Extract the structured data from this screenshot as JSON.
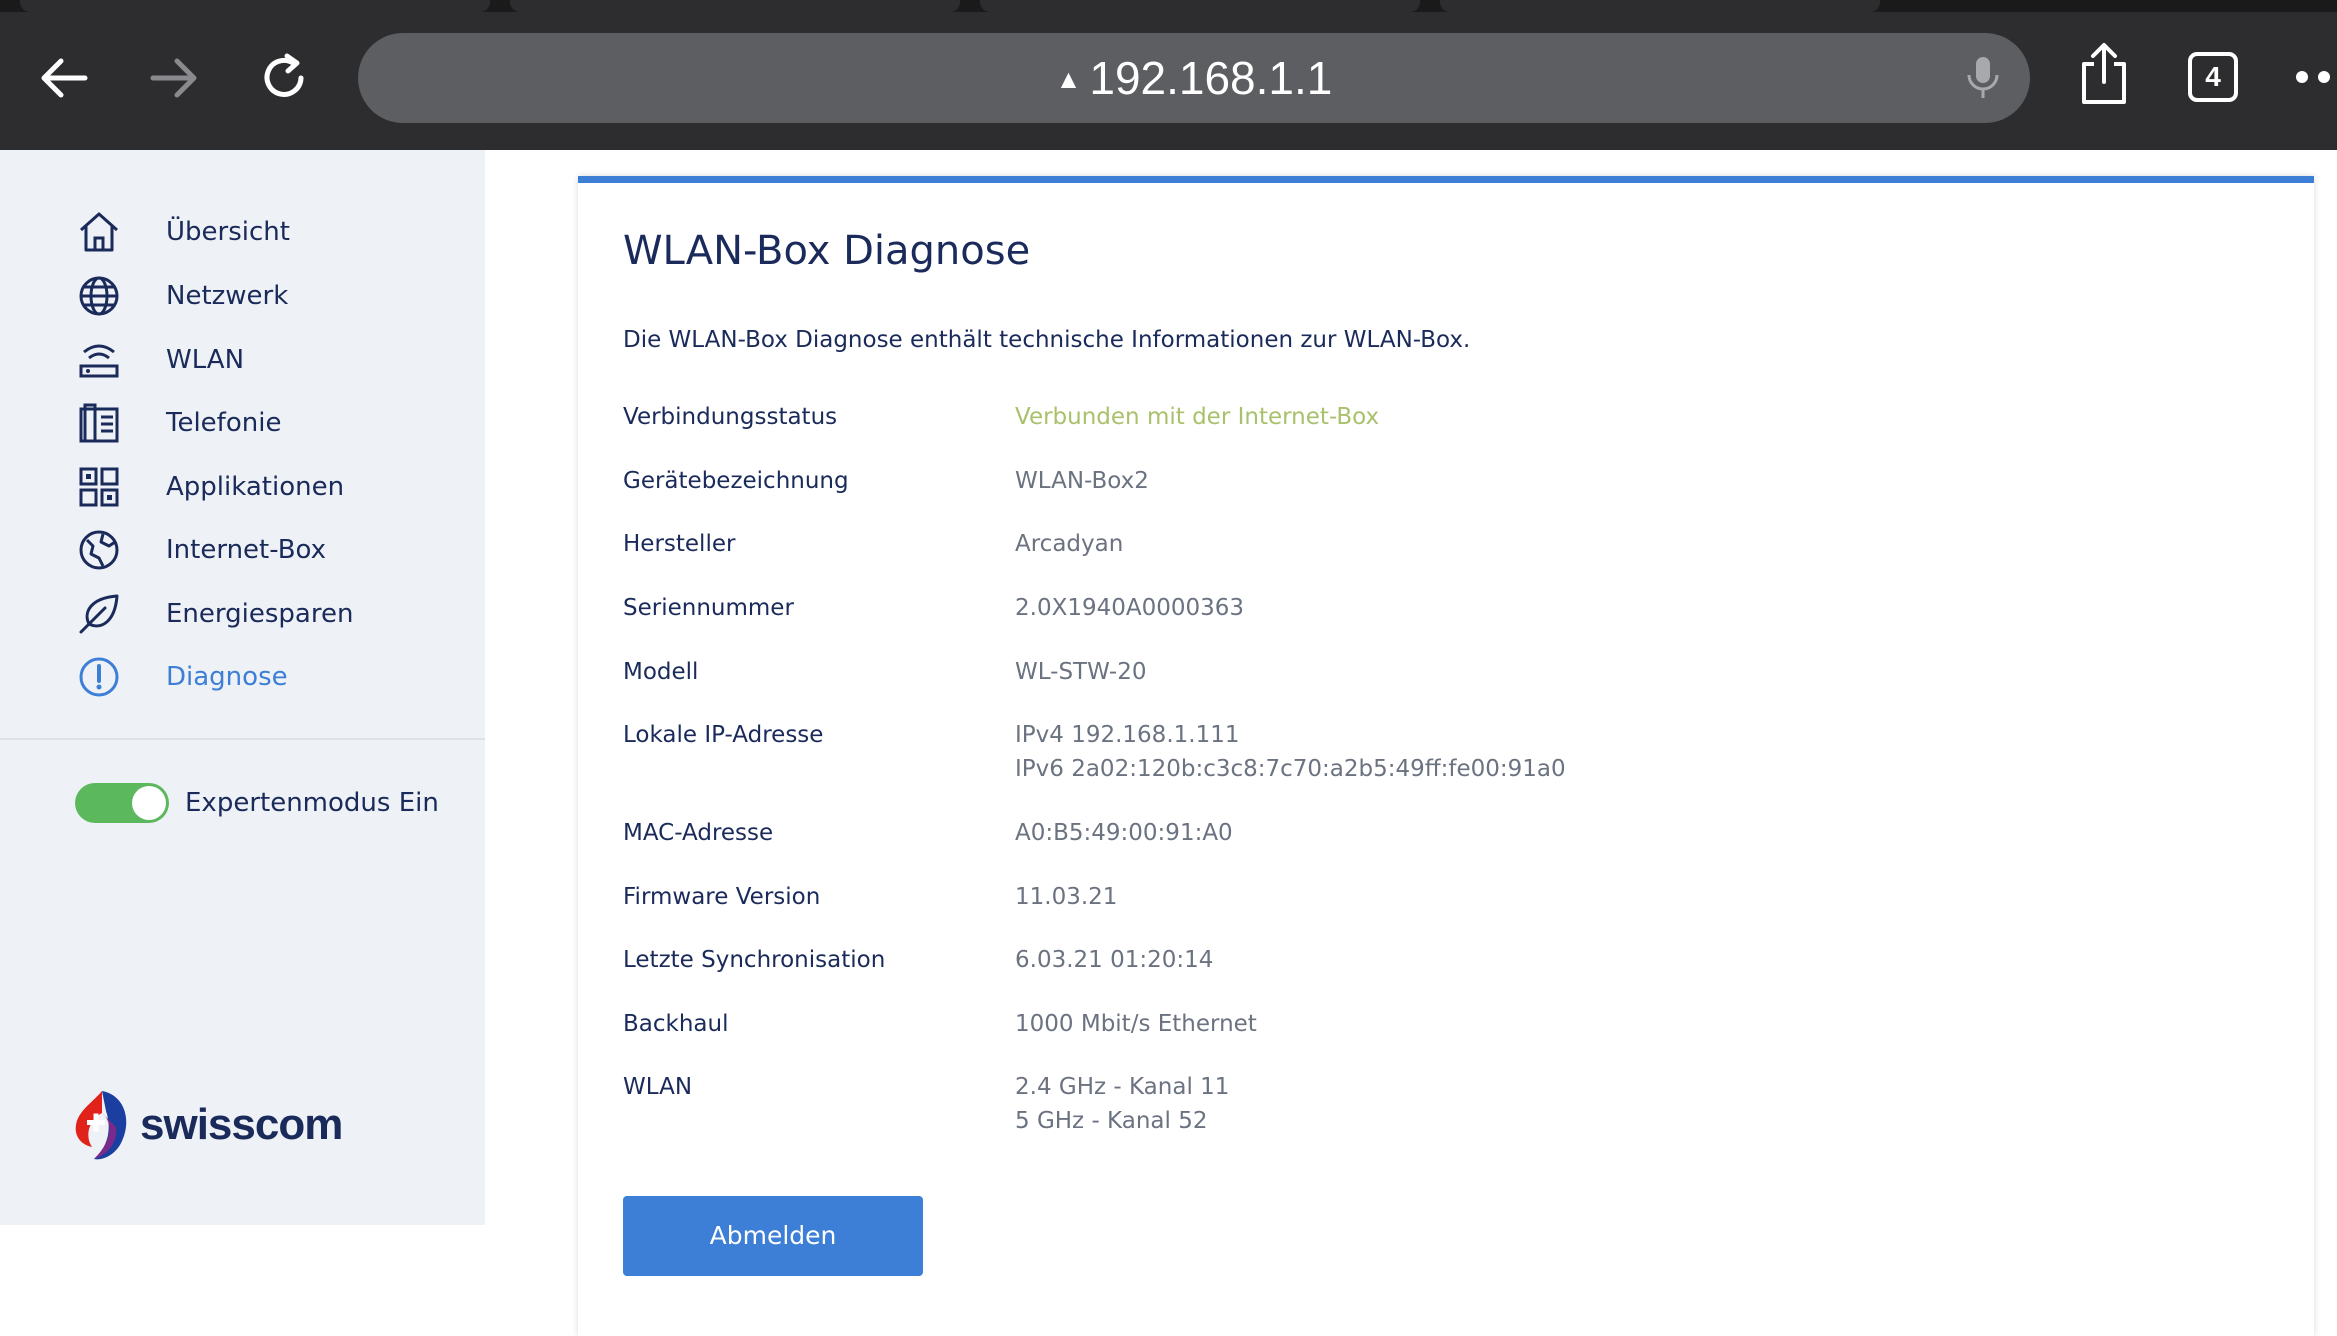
{
  "browser": {
    "url": "192.168.1.1",
    "tab_count": "4"
  },
  "sidebar": {
    "items": [
      {
        "label": "Übersicht",
        "icon": "home-icon"
      },
      {
        "label": "Netzwerk",
        "icon": "globe-icon"
      },
      {
        "label": "WLAN",
        "icon": "router-icon"
      },
      {
        "label": "Telefonie",
        "icon": "phone-icon"
      },
      {
        "label": "Applikationen",
        "icon": "apps-icon"
      },
      {
        "label": "Internet-Box",
        "icon": "internet-box-icon"
      },
      {
        "label": "Energiesparen",
        "icon": "leaf-icon"
      },
      {
        "label": "Diagnose",
        "icon": "alert-circle-icon"
      }
    ],
    "active_item": "Diagnose",
    "expert_mode_label": "Expertenmodus Ein",
    "expert_mode_on": true,
    "logo_text": "swisscom"
  },
  "main": {
    "title": "WLAN-Box Diagnose",
    "description": "Die WLAN-Box Diagnose enthält technische Informationen zur WLAN-Box.",
    "rows": [
      {
        "label": "Verbindungsstatus",
        "lines": [
          "Verbunden mit der Internet-Box"
        ]
      },
      {
        "label": "Gerätebezeichnung",
        "lines": [
          "WLAN-Box2"
        ]
      },
      {
        "label": "Hersteller",
        "lines": [
          "Arcadyan"
        ]
      },
      {
        "label": "Seriennummer",
        "lines": [
          "2.0X1940A0000363"
        ]
      },
      {
        "label": "Modell",
        "lines": [
          "WL-STW-20"
        ]
      },
      {
        "label": "Lokale IP-Adresse",
        "lines": [
          "IPv4 192.168.1.111",
          "IPv6 2a02:120b:c3c8:7c70:a2b5:49ff:fe00:91a0"
        ]
      },
      {
        "label": "MAC-Adresse",
        "lines": [
          "A0:B5:49:00:91:A0"
        ]
      },
      {
        "label": "Firmware Version",
        "lines": [
          "11.03.21"
        ]
      },
      {
        "label": "Letzte Synchronisation",
        "lines": [
          "6.03.21 01:20:14"
        ]
      },
      {
        "label": "Backhaul",
        "lines": [
          "1000 Mbit/s Ethernet"
        ]
      },
      {
        "label": "WLAN",
        "lines": [
          "2.4 GHz - Kanal 11",
          "5 GHz - Kanal 52"
        ]
      }
    ],
    "logout_label": "Abmelden"
  },
  "colors": {
    "accent": "#3d7fd6",
    "status_ok": "#a9c16c",
    "toggle_on": "#5cb85c",
    "text_dark": "#1a2a5a"
  }
}
